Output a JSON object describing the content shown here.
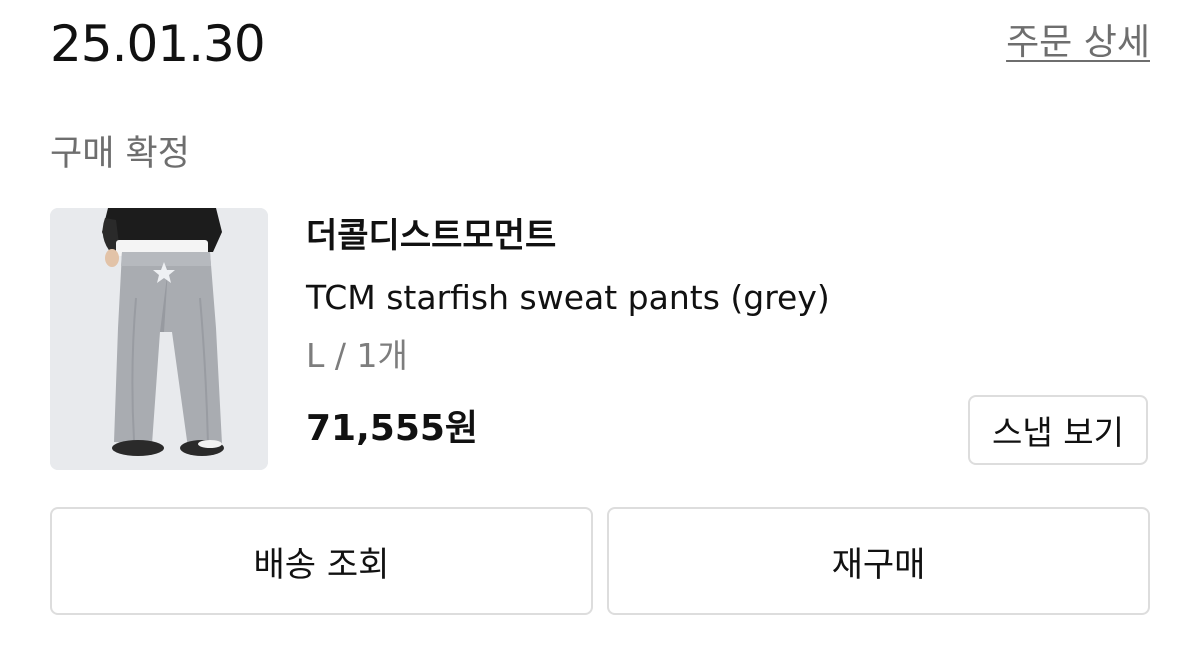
{
  "order": {
    "date": "25.01.30",
    "detail_link_label": "주문 상세",
    "status": "구매 확정"
  },
  "product": {
    "thumbnail_icon": "product-photo-grey-sweat-pants",
    "brand": "더콜디스트모먼트",
    "name": "TCM starfish sweat pants (grey)",
    "option": "L / 1개",
    "price": "71,555원"
  },
  "buttons": {
    "snap_label": "스냅 보기",
    "tracking_label": "배송 조회",
    "reorder_label": "재구매"
  }
}
